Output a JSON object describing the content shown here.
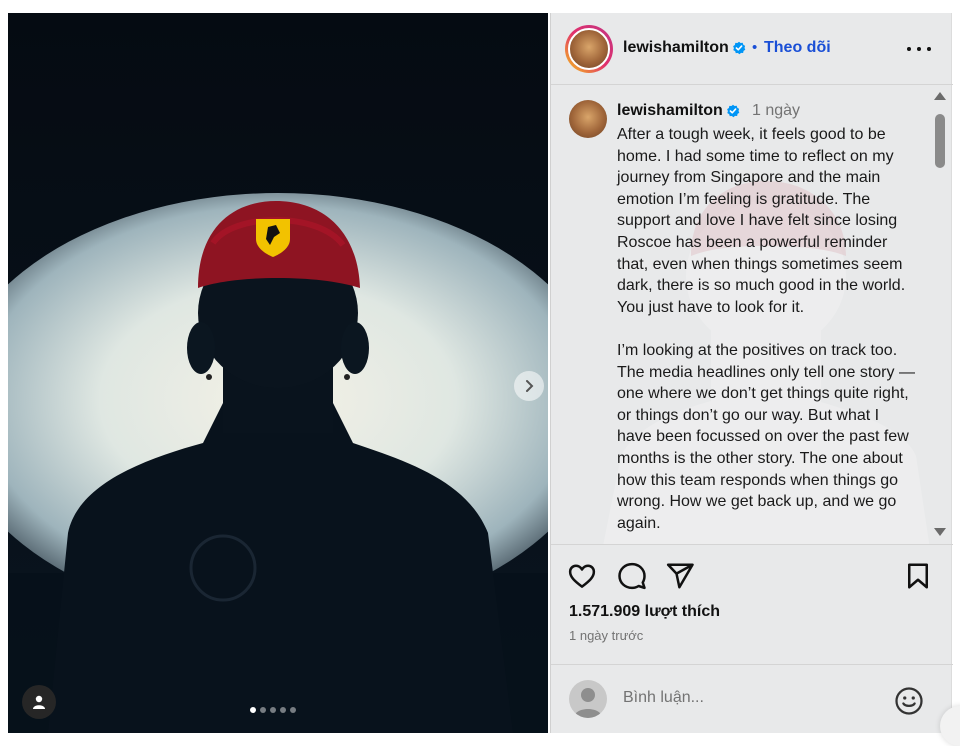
{
  "post": {
    "username": "lewishamilton",
    "follow_separator": "•",
    "follow_label": "Theo dõi",
    "time_short": "1 ngày",
    "caption_p1": "After a tough week, it feels good to be home. I had some time to reflect on my journey from Singapore and the main emotion I’m feeling is gratitude. The support and love I have felt since losing Roscoe has been a powerful reminder that, even when things sometimes seem dark, there is so much good in the world. You just have to look for it.",
    "caption_p2": "I’m looking at the positives on track too. The media headlines only tell one story — one where we don’t get things quite right, or things don’t go our way. But what I have been focussed on over the past few months is the other story. The one about how this team responds when things go wrong. How we get back up, and we go again.",
    "likes": "1.571.909 lượt thích",
    "time_ago": "1 ngày trước"
  },
  "comment": {
    "placeholder": "Bình luận..."
  },
  "media": {
    "slide_count": 5,
    "active_slide": 1
  },
  "icons": {
    "like": "heart-icon",
    "comment": "comment-icon",
    "share": "share-icon",
    "save": "bookmark-icon",
    "next": "chevron-right-icon",
    "tag": "user-tag-icon",
    "more": "more-icon",
    "emoji": "emoji-icon",
    "verified": "verified-badge-icon"
  },
  "colors": {
    "verified": "#0095f6",
    "follow": "#1a4fd6",
    "cap": "#b0142a",
    "ferrari_shield": "#f2c200"
  }
}
